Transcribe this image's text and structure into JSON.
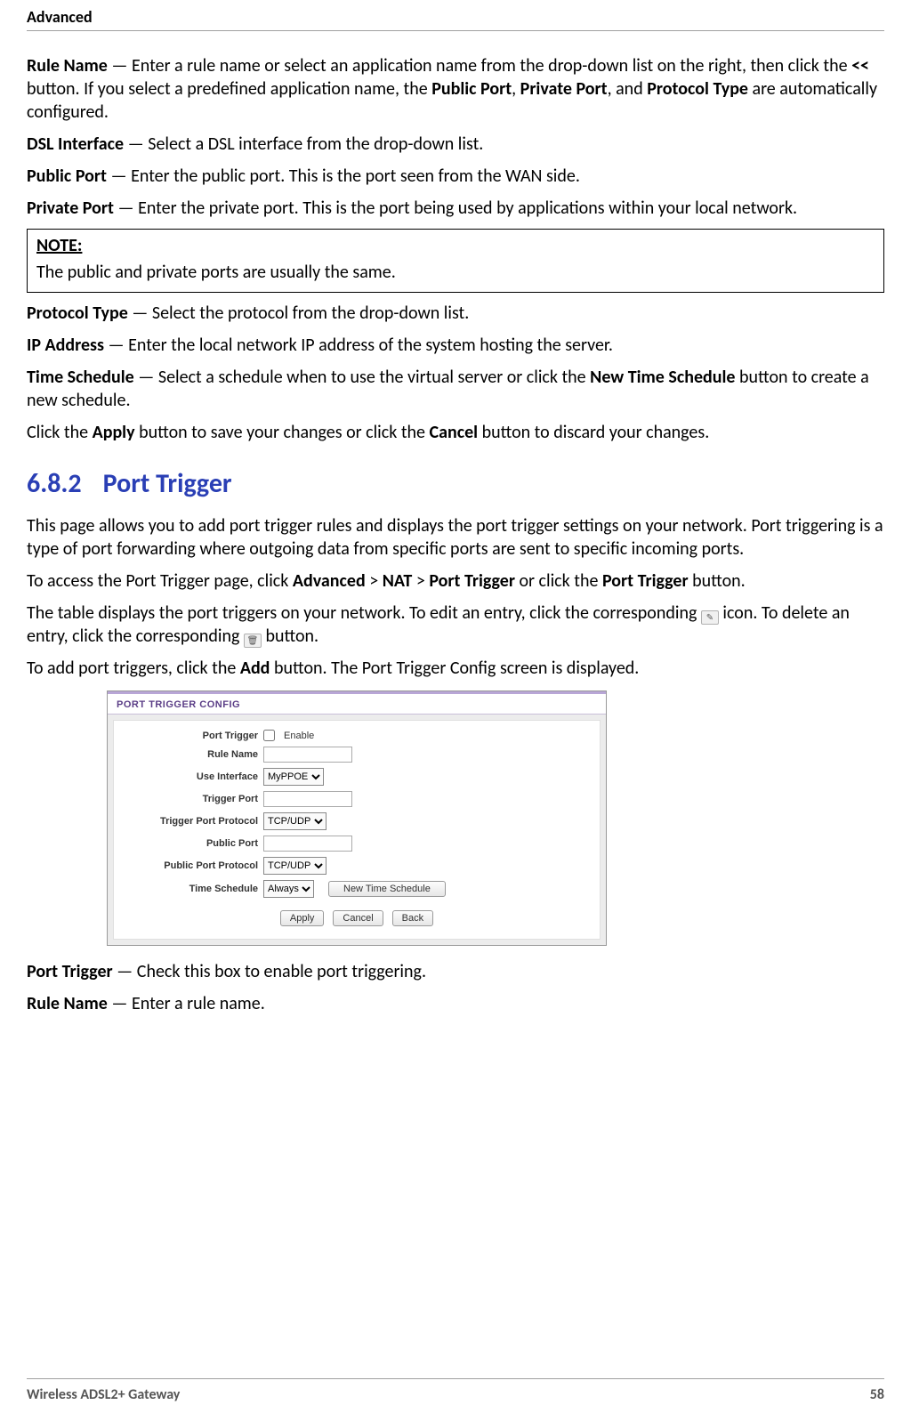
{
  "header": {
    "title": "Advanced"
  },
  "defs": {
    "rule_name": {
      "label": "Rule Name",
      "text_a": " — Enter a rule name or select an application name from the drop-down list on the right, then click the ",
      "bold_mid": "<<",
      "text_b": " button. If you select a predefined application name, the ",
      "bold_1": "Public Port",
      "sep1": ", ",
      "bold_2": "Private Port",
      "sep2": ", and ",
      "bold_3": "Protocol Type",
      "text_c": " are automatically configured."
    },
    "dsl_interface": {
      "label": "DSL Interface",
      "text": " — Select a DSL interface from the drop-down list."
    },
    "public_port": {
      "label": "Public Port",
      "text": " — Enter the public port. This is the port seen from the WAN side."
    },
    "private_port": {
      "label": "Private Port",
      "text": " — Enter the private port. This is the port being used by applications within your local network."
    },
    "note": {
      "label": "NOTE:",
      "text": "The public and private ports are usually the same."
    },
    "protocol_type": {
      "label": "Protocol Type",
      "text": " — Select the protocol from the drop-down list."
    },
    "ip_address": {
      "label": "IP Address",
      "text": " — Enter the local network IP address of the system hosting the server."
    },
    "time_schedule": {
      "label": "Time Schedule",
      "text_a": " — Select a schedule when to use the virtual server or click the ",
      "bold_1": "New Time Schedule",
      "text_b": " button to create a new schedule."
    },
    "apply_cancel": {
      "text_a": "Click the ",
      "bold_1": "Apply",
      "text_b": " button to save your changes or click the ",
      "bold_2": "Cancel",
      "text_c": " button to discard your changes."
    }
  },
  "section": {
    "number": "6.8.2",
    "title": "Port Trigger"
  },
  "trigger": {
    "intro": "This page allows you to add port trigger rules and displays the port trigger settings on your network. Port triggering is a type of port forwarding where outgoing data from specific ports are sent to specific incoming ports.",
    "access_a": "To access the Port Trigger page, click ",
    "access_b1": "Advanced",
    "access_sep1": " > ",
    "access_b2": "NAT",
    "access_sep2": " > ",
    "access_b3": "Port Trigger",
    "access_mid": " or click the ",
    "access_b4": "Port Trigger",
    "access_end": " button.",
    "table_a": "The table displays the port triggers on your network. To edit an entry, click the corresponding ",
    "icon_edit": "✎",
    "table_mid": " icon. To delete an entry, click the corresponding ",
    "icon_delete": "🗑",
    "table_end": " button.",
    "add_a": "To add port triggers, click the ",
    "add_b": "Add",
    "add_end": " button. The Port Trigger Config screen is displayed."
  },
  "form": {
    "title": "PORT TRIGGER CONFIG",
    "rows": {
      "port_trigger": {
        "label": "Port Trigger",
        "cb_text": "Enable"
      },
      "rule_name": {
        "label": "Rule Name"
      },
      "use_interface": {
        "label": "Use Interface",
        "value": "MyPPOE"
      },
      "trigger_port": {
        "label": "Trigger Port"
      },
      "trigger_proto": {
        "label": "Trigger Port Protocol",
        "value": "TCP/UDP"
      },
      "public_port": {
        "label": "Public Port"
      },
      "public_proto": {
        "label": "Public Port Protocol",
        "value": "TCP/UDP"
      },
      "time_schedule": {
        "label": "Time Schedule",
        "value": "Always",
        "btn": "New Time Schedule"
      }
    },
    "buttons": {
      "apply": "Apply",
      "cancel": "Cancel",
      "back": "Back"
    }
  },
  "defs2": {
    "port_trigger": {
      "label": "Port Trigger",
      "text": " — Check this box to enable port triggering."
    },
    "rule_name": {
      "label": "Rule Name",
      "text": " — Enter a rule name."
    }
  },
  "footer": {
    "product": "Wireless ADSL2+ Gateway",
    "page": "58"
  }
}
